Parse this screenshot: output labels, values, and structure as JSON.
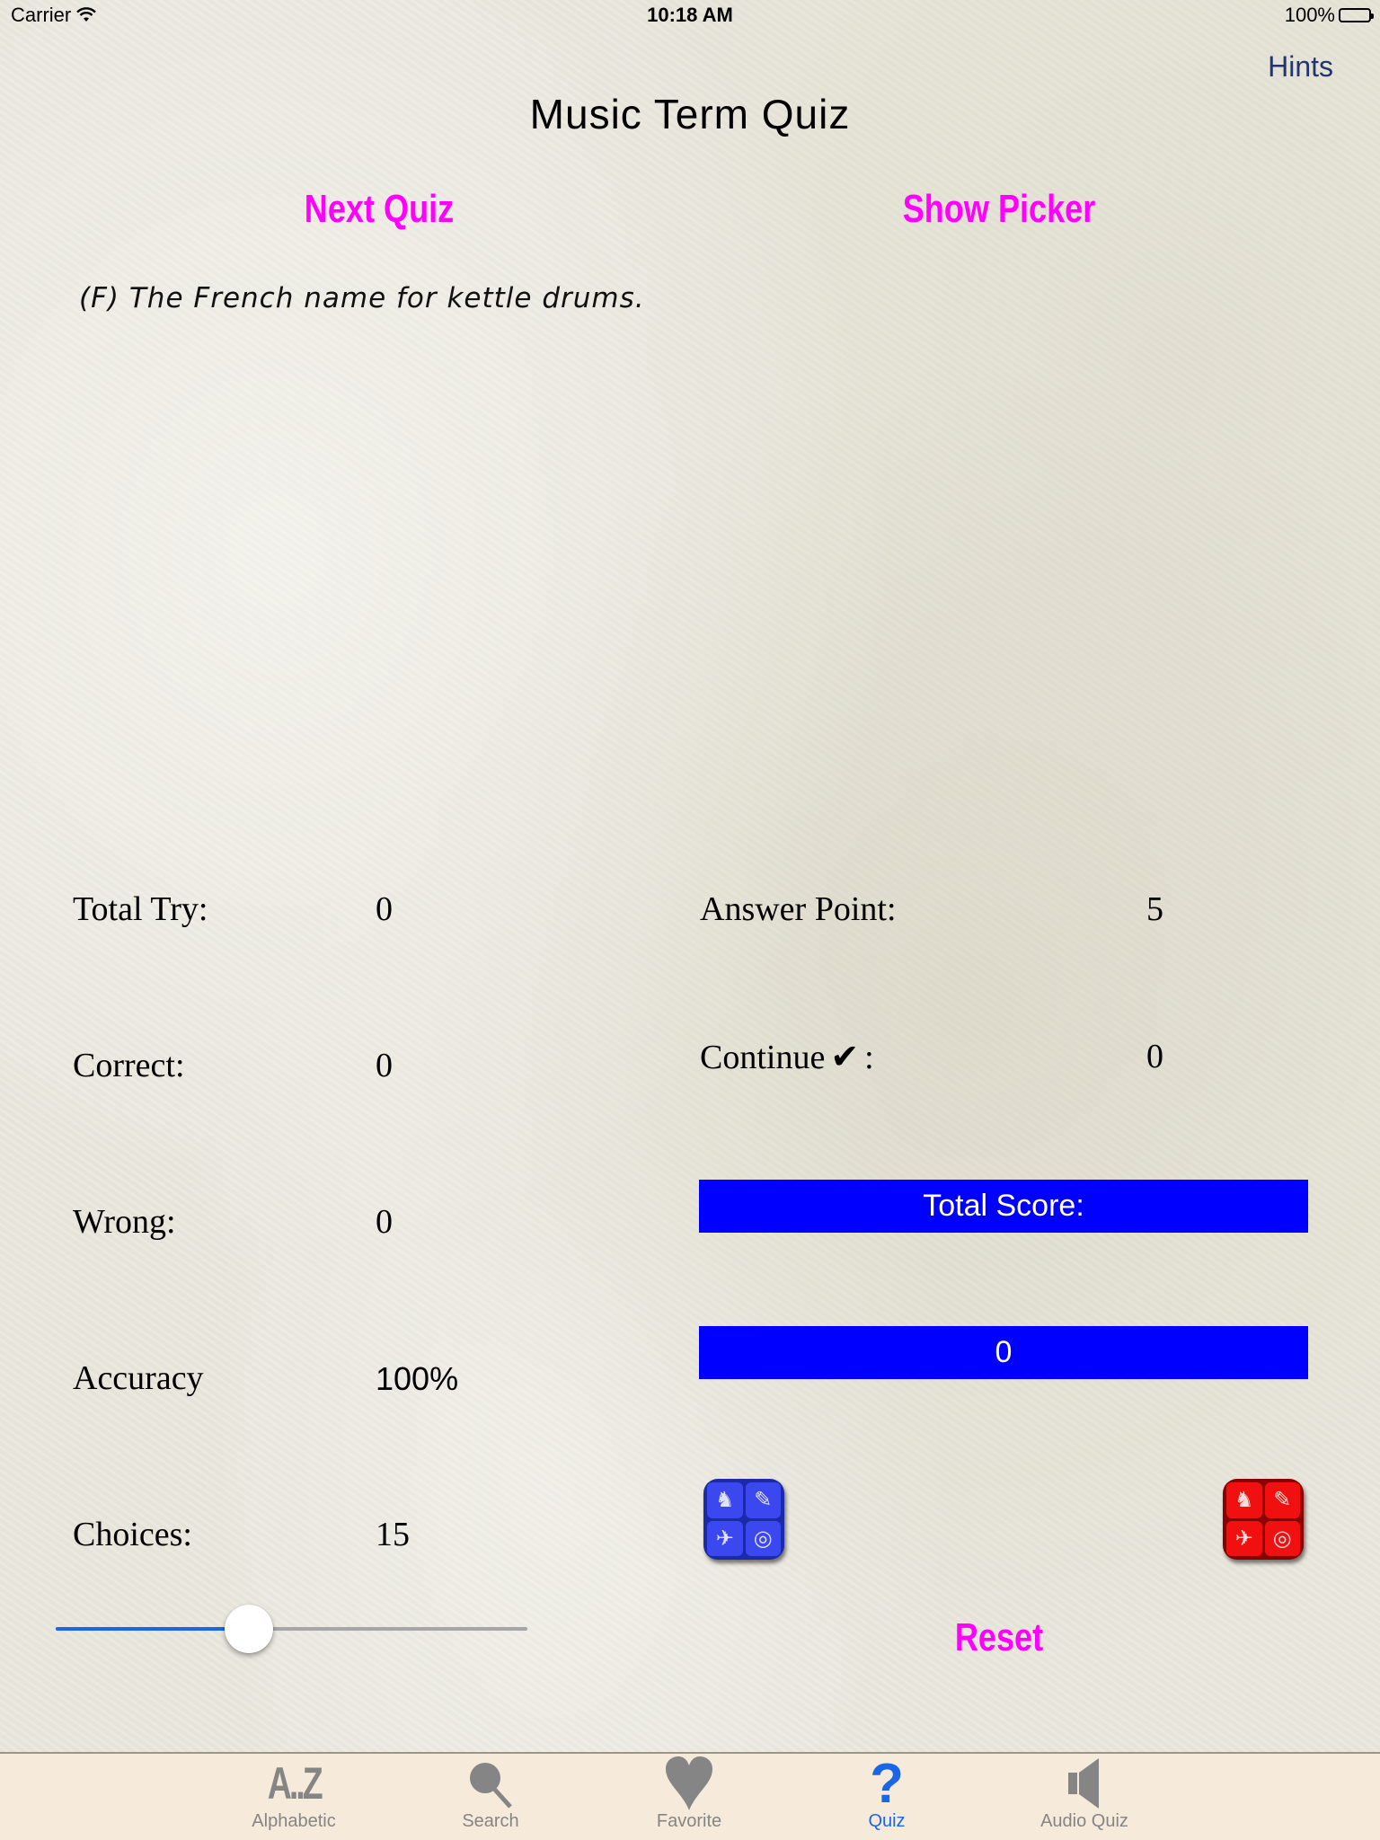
{
  "status_bar": {
    "carrier": "Carrier",
    "time": "10:18 AM",
    "battery": "100%"
  },
  "nav": {
    "hints_label": "Hints",
    "title": "Music Term Quiz"
  },
  "actions": {
    "next_quiz_label": "Next Quiz",
    "show_picker_label": "Show Picker",
    "reset_label": "Reset"
  },
  "question": {
    "text": "(F) The French name for kettle drums."
  },
  "stats_left": [
    {
      "label": "Total Try:",
      "value": "0"
    },
    {
      "label": "Correct:",
      "value": "0"
    },
    {
      "label": "Wrong:",
      "value": "0"
    },
    {
      "label": "Accuracy",
      "value": "100%"
    },
    {
      "label": "Choices:",
      "value": "15"
    }
  ],
  "stats_right": {
    "answer_point_label": "Answer Point:",
    "answer_point_value": "5",
    "continue_label": "Continue",
    "continue_check": "✔",
    "continue_colon": ":",
    "continue_value": "0",
    "total_score_label": "Total Score:",
    "total_score_value": "0"
  },
  "choices_slider": {
    "fraction": 0.41
  },
  "category_buttons": [
    {
      "name": "blue",
      "icons": [
        "♞",
        "✎",
        "✈",
        "◎"
      ]
    },
    {
      "name": "red",
      "icons": [
        "♞",
        "✎",
        "✈",
        "◎"
      ]
    }
  ],
  "tab_bar": {
    "items": [
      {
        "label": "Alphabetic",
        "icon": "A..Z",
        "active": false
      },
      {
        "label": "Search",
        "icon": "search-icon",
        "active": false
      },
      {
        "label": "Favorite",
        "icon": "heart-icon",
        "active": false
      },
      {
        "label": "Quiz",
        "icon": "question-icon",
        "active": true
      },
      {
        "label": "Audio Quiz",
        "icon": "speaker-icon",
        "active": false
      }
    ]
  },
  "colors": {
    "accent_magenta": "#ff00ff",
    "score_bar": "#0000ff",
    "tab_active": "#1a66e6",
    "tab_inactive": "#858585",
    "hints": "#23356b"
  }
}
